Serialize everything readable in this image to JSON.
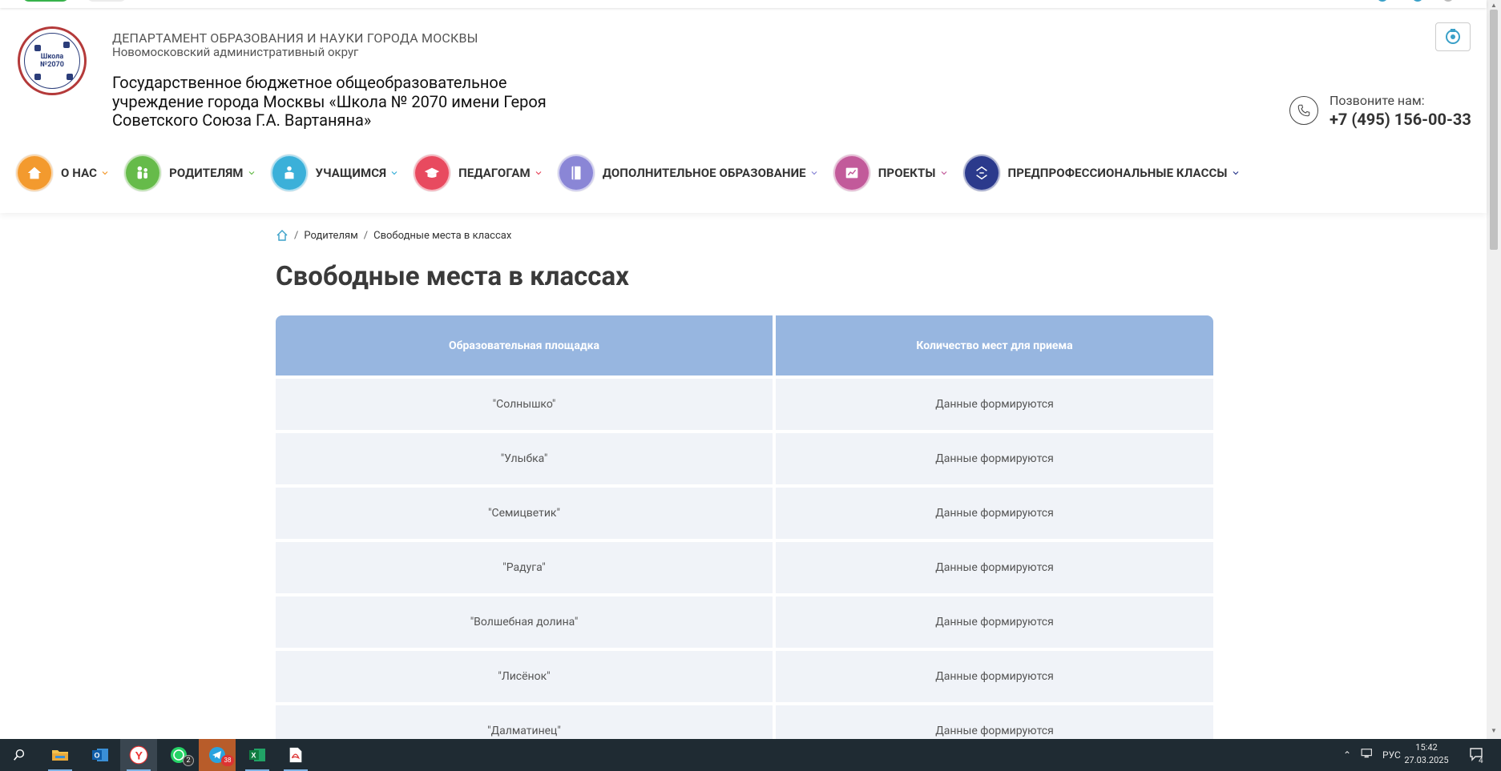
{
  "header": {
    "logo_line1": "Школа",
    "logo_line2": "№2070",
    "department": "ДЕПАРТАМЕНТ ОБРАЗОВАНИЯ И НАУКИ ГОРОДА МОСКВЫ",
    "district": "Новомосковский административный округ",
    "school_name": "Государственное бюджетное общеобразовательное учреждение города Москвы «Школа № 2070 имени Героя Советского Союза Г.А. Вартаняна»",
    "phone_label": "Позвоните нам:",
    "phone_number": "+7 (495) 156-00-33"
  },
  "nav": {
    "items": [
      {
        "label": "О НАС",
        "color": "#f39a2e",
        "icon": "house-icon"
      },
      {
        "label": "РОДИТЕЛЯМ",
        "color": "#66bb4a",
        "icon": "family-icon"
      },
      {
        "label": "УЧАЩИМСЯ",
        "color": "#3bb0d9",
        "icon": "student-icon"
      },
      {
        "label": "ПЕДАГОГАМ",
        "color": "#e84a5f",
        "icon": "graduation-cap-icon"
      },
      {
        "label": "ДОПОЛНИТЕЛЬНОЕ ОБРАЗОВАНИЕ",
        "color": "#8a86d6",
        "icon": "book-icon"
      },
      {
        "label": "ПРОЕКТЫ",
        "color": "#c25a9a",
        "icon": "presentation-icon"
      },
      {
        "label": "ПРЕДПРОФЕССИОНАЛЬНЫЕ КЛАССЫ",
        "color": "#2b3a8c",
        "icon": "arrows-icon"
      }
    ]
  },
  "breadcrumb": {
    "items": [
      "Родителям",
      "Свободные места в классах"
    ]
  },
  "page": {
    "title": "Свободные места в классах"
  },
  "table": {
    "headers": [
      "Образовательная площадка",
      "Количество мест для приема"
    ],
    "rows": [
      [
        "\"Солнышко\"",
        "Данные формируются"
      ],
      [
        "\"Улыбка\"",
        "Данные формируются"
      ],
      [
        "\"Семицветик\"",
        "Данные формируются"
      ],
      [
        "\"Радуга\"",
        "Данные формируются"
      ],
      [
        "\"Волшебная долина\"",
        "Данные формируются"
      ],
      [
        "\"Лисёнок\"",
        "Данные формируются"
      ],
      [
        "\"Далматинец\"",
        "Данные формируются"
      ]
    ]
  },
  "taskbar": {
    "whatsapp_badge": "2",
    "telegram_badge": "38",
    "language": "РУС",
    "time": "15:42",
    "date": "27.03.2025",
    "notifications": "4"
  }
}
